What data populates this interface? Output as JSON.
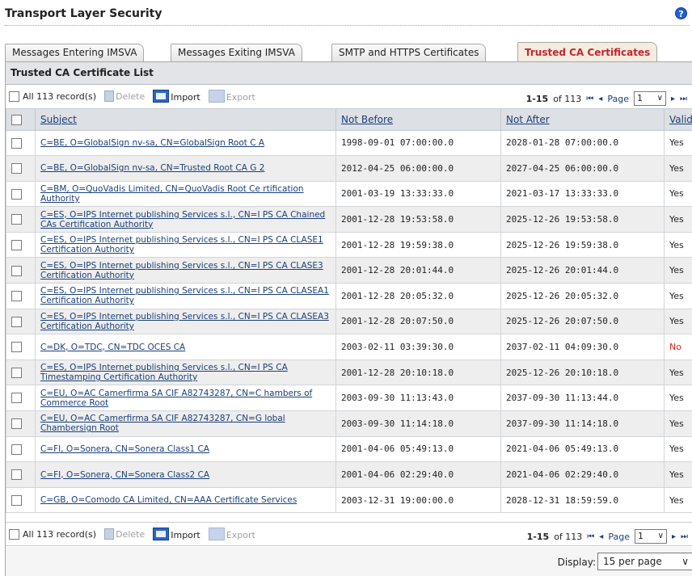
{
  "page": {
    "title": "Transport Layer Security",
    "help": "?"
  },
  "tabs": [
    {
      "label": "Messages Entering IMSVA",
      "active": false
    },
    {
      "label": "Messages Exiting IMSVA",
      "active": false
    },
    {
      "label": "SMTP and HTTPS Certificates",
      "active": false
    },
    {
      "label": "Trusted CA Certificates",
      "active": true
    }
  ],
  "panel": {
    "title": "Trusted CA Certificate List"
  },
  "toolbar": {
    "all_records": "All 113 record(s)",
    "delete": "Delete",
    "import": "Import",
    "export": "Export",
    "range": "1-15",
    "of_total": "of 113",
    "first": "⏮",
    "prev": "◂",
    "page_word": "Page",
    "page_value": "1",
    "next": "▸",
    "last": "⏭"
  },
  "columns": {
    "subject": "Subject",
    "not_before": "Not Before",
    "not_after": "Not After",
    "valid": "Valid"
  },
  "rows": [
    {
      "subject": "C=BE, O=GlobalSign nv-sa, CN=GlobalSign Root C A",
      "not_before": "1998-09-01 07:00:00.0",
      "not_after": "2028-01-28 07:00:00.0",
      "valid": "Yes"
    },
    {
      "subject": "C=BE, O=GlobalSign nv-sa, CN=Trusted Root CA G 2",
      "not_before": "2012-04-25 06:00:00.0",
      "not_after": "2027-04-25 06:00:00.0",
      "valid": "Yes"
    },
    {
      "subject": "C=BM, O=QuoVadis Limited, CN=QuoVadis Root Ce rtification Authority",
      "not_before": "2001-03-19 13:33:33.0",
      "not_after": "2021-03-17 13:33:33.0",
      "valid": "Yes"
    },
    {
      "subject": "C=ES, O=IPS Internet publishing Services s.l., CN=I PS CA Chained CAs Certification Authority",
      "not_before": "2001-12-28 19:53:58.0",
      "not_after": "2025-12-26 19:53:58.0",
      "valid": "Yes"
    },
    {
      "subject": "C=ES, O=IPS Internet publishing Services s.l., CN=I PS CA CLASE1 Certification Authority",
      "not_before": "2001-12-28 19:59:38.0",
      "not_after": "2025-12-26 19:59:38.0",
      "valid": "Yes"
    },
    {
      "subject": "C=ES, O=IPS Internet publishing Services s.l., CN=I PS CA CLASE3 Certification Authority",
      "not_before": "2001-12-28 20:01:44.0",
      "not_after": "2025-12-26 20:01:44.0",
      "valid": "Yes"
    },
    {
      "subject": "C=ES, O=IPS Internet publishing Services s.l., CN=I PS CA CLASEA1 Certification Authority",
      "not_before": "2001-12-28 20:05:32.0",
      "not_after": "2025-12-26 20:05:32.0",
      "valid": "Yes"
    },
    {
      "subject": "C=ES, O=IPS Internet publishing Services s.l., CN=I PS CA CLASEA3 Certification Authority",
      "not_before": "2001-12-28 20:07:50.0",
      "not_after": "2025-12-26 20:07:50.0",
      "valid": "Yes"
    },
    {
      "subject": "C=DK, O=TDC, CN=TDC OCES CA",
      "not_before": "2003-02-11 03:39:30.0",
      "not_after": "2037-02-11 04:09:30.0",
      "valid": "No"
    },
    {
      "subject": "C=ES, O=IPS Internet publishing Services s.l., CN=I PS CA Timestamping Certification Authority",
      "not_before": "2001-12-28 20:10:18.0",
      "not_after": "2025-12-26 20:10:18.0",
      "valid": "Yes"
    },
    {
      "subject": "C=EU, O=AC Camerfirma SA CIF A82743287, CN=C hambers of Commerce Root",
      "not_before": "2003-09-30 11:13:43.0",
      "not_after": "2037-09-30 11:13:44.0",
      "valid": "Yes"
    },
    {
      "subject": "C=EU, O=AC Camerfirma SA CIF A82743287, CN=G lobal Chambersign Root",
      "not_before": "2003-09-30 11:14:18.0",
      "not_after": "2037-09-30 11:14:18.0",
      "valid": "Yes"
    },
    {
      "subject": "C=FI, O=Sonera, CN=Sonera Class1 CA",
      "not_before": "2001-04-06 05:49:13.0",
      "not_after": "2021-04-06 05:49:13.0",
      "valid": "Yes"
    },
    {
      "subject": "C=FI, O=Sonera, CN=Sonera Class2 CA",
      "not_before": "2001-04-06 02:29:40.0",
      "not_after": "2021-04-06 02:29:40.0",
      "valid": "Yes"
    },
    {
      "subject": "C=GB, O=Comodo CA Limited, CN=AAA Certificate Services",
      "not_before": "2003-12-31 19:00:00.0",
      "not_after": "2028-12-31 18:59:59.0",
      "valid": "Yes"
    }
  ],
  "display": {
    "label": "Display:",
    "value": "15 per page"
  },
  "colors": {
    "active_tab_text": "#c1272d",
    "link": "#1a3f7a",
    "invalid": "#d4231b",
    "help": "#1c5fd6"
  }
}
